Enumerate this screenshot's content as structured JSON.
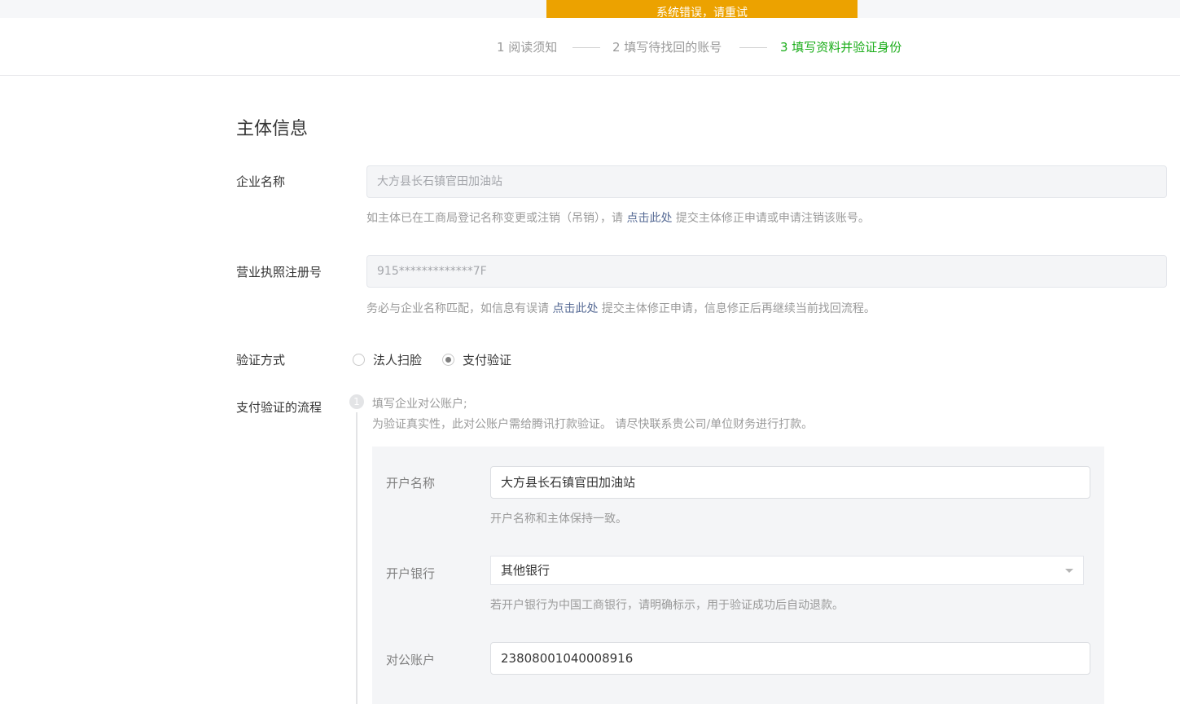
{
  "toast": {
    "text": "系统错误，请重试"
  },
  "steps": [
    {
      "label": "1 阅读须知"
    },
    {
      "label": "2 填写待找回的账号"
    },
    {
      "label": "3 填写资料并验证身份"
    }
  ],
  "section": {
    "title": "主体信息"
  },
  "company": {
    "label": "企业名称",
    "value": "大方县长石镇官田加油站",
    "tip_before": "如主体已在工商局登记名称变更或注销（吊销），请",
    "tip_link": "点击此处",
    "tip_after": "提交主体修正申请或申请注销该账号。"
  },
  "license": {
    "label": "营业执照注册号",
    "value": "915*************7F",
    "tip_before": "务必与企业名称匹配，如信息有误请",
    "tip_link": "点击此处",
    "tip_after": "提交主体修正申请，信息修正后再继续当前找回流程。"
  },
  "verify": {
    "label": "验证方式",
    "options": [
      {
        "label": "法人扫脸",
        "checked": false
      },
      {
        "label": "支付验证",
        "checked": true
      }
    ]
  },
  "flow": {
    "label": "支付验证的流程",
    "step_number": "1",
    "step_title": "填写企业对公账户;",
    "step_desc": "为验证真实性，此对公账户需给腾讯打款验证。 请尽快联系贵公司/单位财务进行打款。"
  },
  "payment": {
    "account_name_label": "开户名称",
    "account_name_value": "大方县长石镇官田加油站",
    "account_name_tip": "开户名称和主体保持一致。",
    "bank_label": "开户银行",
    "bank_value": "其他银行",
    "bank_tip": "若开户银行为中国工商银行，请明确标示，用于验证成功后自动退款。",
    "account_label": "对公账户",
    "account_value": "23808001040008916"
  },
  "icons": {
    "caret": "chevron-down-icon",
    "radio_checked_color": "#7f7f7f",
    "accent": "#1aad19",
    "toast_bg": "#eca200",
    "link": "#576b95"
  }
}
